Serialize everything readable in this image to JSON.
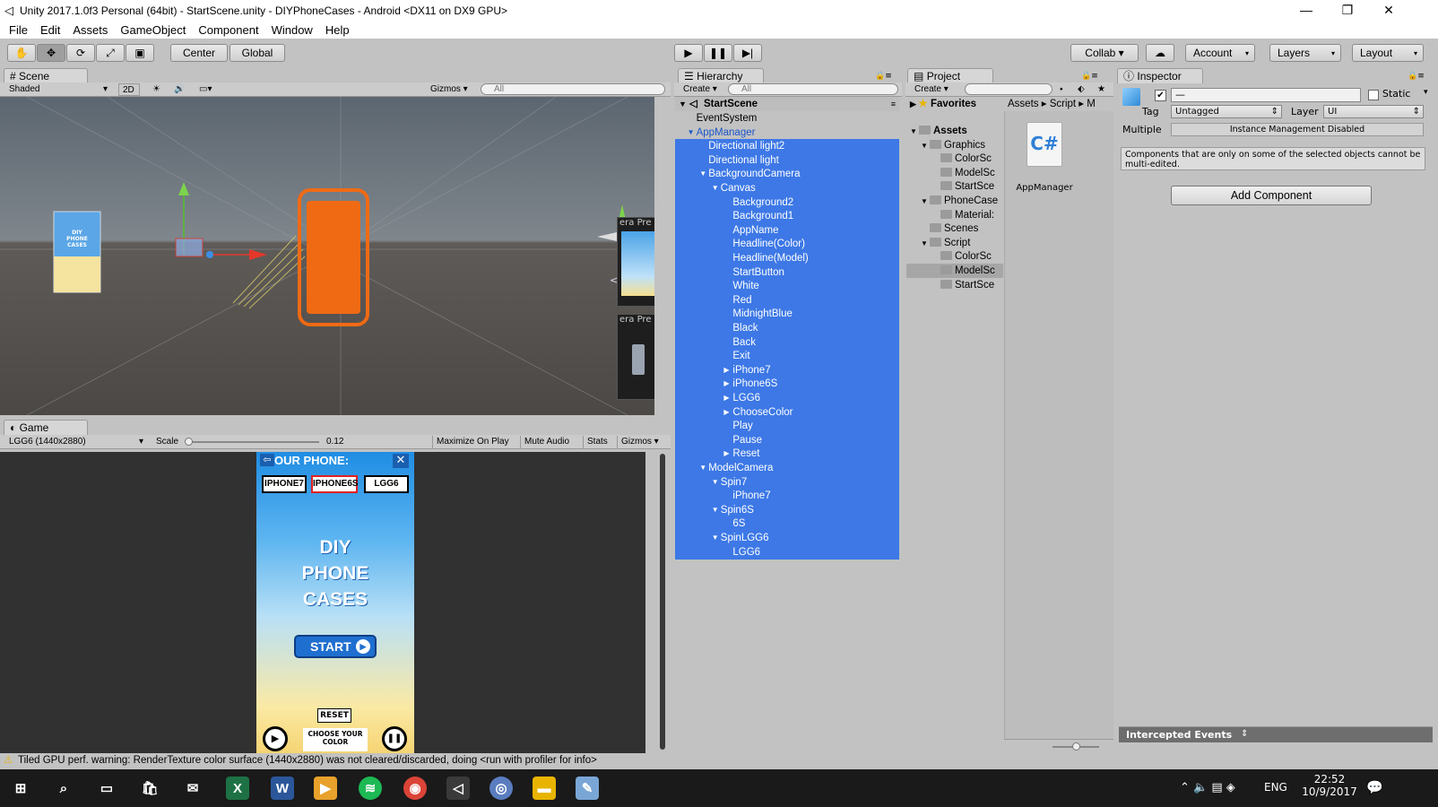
{
  "window": {
    "title": "Unity 2017.1.0f3 Personal (64bit) - StartScene.unity - DIYPhoneCases - Android <DX11 on DX9 GPU>",
    "minimize": "—",
    "maximize": "❐",
    "close": "✕"
  },
  "menu": [
    "File",
    "Edit",
    "Assets",
    "GameObject",
    "Component",
    "Window",
    "Help"
  ],
  "toolbar": {
    "pivot": "Center",
    "space": "Global",
    "collab": "Collab ▾",
    "account": "Account",
    "layers": "Layers",
    "layout": "Layout"
  },
  "scene_panel": {
    "tab": "Scene",
    "shading": "Shaded",
    "mode_2d": "2D",
    "gizmos": "Gizmos",
    "search_placeholder": "All",
    "persp_label": "< Back",
    "preview_label": "era Pre",
    "preview_label2": "era Pre"
  },
  "game_panel": {
    "tab": "Game",
    "resolution": "LGG6 (1440x2880)",
    "scale_label": "Scale",
    "scale_value": "0.12",
    "maximize": "Maximize On Play",
    "mute": "Mute Audio",
    "stats": "Stats",
    "gizmos": "Gizmos",
    "phone": {
      "header": "OUR PHONE:",
      "buttons": [
        "IPHONE7",
        "IPHONE6S",
        "LGG6"
      ],
      "title_lines": [
        "DIY",
        "PHONE",
        "CASES"
      ],
      "start": "START",
      "reset": "RESET",
      "choose": "CHOOSE YOUR COLOR"
    }
  },
  "hierarchy": {
    "tab": "Hierarchy",
    "create": "Create",
    "search_placeholder": "All",
    "scene": "StartScene",
    "items": [
      {
        "label": "EventSystem",
        "depth": 1,
        "arrow": "",
        "selected": false
      },
      {
        "label": "AppManager",
        "depth": 1,
        "arrow": "▼",
        "selected": false,
        "highlight": true
      },
      {
        "label": "Directional light2",
        "depth": 2,
        "arrow": "",
        "selected": true
      },
      {
        "label": "Directional light",
        "depth": 2,
        "arrow": "",
        "selected": true
      },
      {
        "label": "BackgroundCamera",
        "depth": 2,
        "arrow": "▼",
        "selected": true
      },
      {
        "label": "Canvas",
        "depth": 3,
        "arrow": "▼",
        "selected": true
      },
      {
        "label": "Background2",
        "depth": 4,
        "arrow": "",
        "selected": true
      },
      {
        "label": "Background1",
        "depth": 4,
        "arrow": "",
        "selected": true
      },
      {
        "label": "AppName",
        "depth": 4,
        "arrow": "",
        "selected": true
      },
      {
        "label": "Headline(Color)",
        "depth": 4,
        "arrow": "",
        "selected": true
      },
      {
        "label": "Headline(Model)",
        "depth": 4,
        "arrow": "",
        "selected": true
      },
      {
        "label": "StartButton",
        "depth": 4,
        "arrow": "",
        "selected": true
      },
      {
        "label": "White",
        "depth": 4,
        "arrow": "",
        "selected": true
      },
      {
        "label": "Red",
        "depth": 4,
        "arrow": "",
        "selected": true
      },
      {
        "label": "MidnightBlue",
        "depth": 4,
        "arrow": "",
        "selected": true
      },
      {
        "label": "Black",
        "depth": 4,
        "arrow": "",
        "selected": true
      },
      {
        "label": "Back",
        "depth": 4,
        "arrow": "",
        "selected": true
      },
      {
        "label": "Exit",
        "depth": 4,
        "arrow": "",
        "selected": true
      },
      {
        "label": "iPhone7",
        "depth": 4,
        "arrow": "▶",
        "selected": true
      },
      {
        "label": "iPhone6S",
        "depth": 4,
        "arrow": "▶",
        "selected": true
      },
      {
        "label": "LGG6",
        "depth": 4,
        "arrow": "▶",
        "selected": true
      },
      {
        "label": "ChooseColor",
        "depth": 4,
        "arrow": "▶",
        "selected": true
      },
      {
        "label": "Play",
        "depth": 4,
        "arrow": "",
        "selected": true
      },
      {
        "label": "Pause",
        "depth": 4,
        "arrow": "",
        "selected": true
      },
      {
        "label": "Reset",
        "depth": 4,
        "arrow": "▶",
        "selected": true
      },
      {
        "label": "ModelCamera",
        "depth": 2,
        "arrow": "▼",
        "selected": true
      },
      {
        "label": "Spin7",
        "depth": 3,
        "arrow": "▼",
        "selected": true
      },
      {
        "label": "iPhone7",
        "depth": 4,
        "arrow": "",
        "selected": true
      },
      {
        "label": "Spin6S",
        "depth": 3,
        "arrow": "▼",
        "selected": true
      },
      {
        "label": "6S",
        "depth": 4,
        "arrow": "",
        "selected": true
      },
      {
        "label": "SpinLGG6",
        "depth": 3,
        "arrow": "▼",
        "selected": true
      },
      {
        "label": "LGG6",
        "depth": 4,
        "arrow": "",
        "selected": true
      }
    ]
  },
  "project": {
    "tab": "Project",
    "create": "Create",
    "breadcrumb": [
      "Assets",
      "Script",
      "M"
    ],
    "favorites": "Favorites",
    "tree": [
      {
        "label": "Assets",
        "depth": 0,
        "arrow": "▼",
        "bold": true
      },
      {
        "label": "Graphics",
        "depth": 1,
        "arrow": "▼"
      },
      {
        "label": "ColorSc",
        "depth": 2,
        "arrow": ""
      },
      {
        "label": "ModelSc",
        "depth": 2,
        "arrow": ""
      },
      {
        "label": "StartSce",
        "depth": 2,
        "arrow": ""
      },
      {
        "label": "PhoneCase",
        "depth": 1,
        "arrow": "▼"
      },
      {
        "label": "Material:",
        "depth": 2,
        "arrow": ""
      },
      {
        "label": "Scenes",
        "depth": 1,
        "arrow": ""
      },
      {
        "label": "Script",
        "depth": 1,
        "arrow": "▼"
      },
      {
        "label": "ColorSc",
        "depth": 2,
        "arrow": ""
      },
      {
        "label": "ModelSc",
        "depth": 2,
        "arrow": "",
        "selected": true
      },
      {
        "label": "StartSce",
        "depth": 2,
        "arrow": ""
      }
    ],
    "asset": {
      "label": "AppManager",
      "icon": "C#"
    }
  },
  "inspector": {
    "tab": "Inspector",
    "name_value": "—",
    "static": "Static",
    "tag_label": "Tag",
    "tag_value": "Untagged",
    "layer_label": "Layer",
    "layer_value": "UI",
    "multiple_label": "Multiple",
    "multiple_value": "Instance Management Disabled",
    "notice": "Components that are only on some of the selected objects cannot be multi-edited.",
    "add_component": "Add Component",
    "intercepted": "Intercepted Events"
  },
  "status": {
    "message": "Tiled GPU perf. warning: RenderTexture color surface  (1440x2880) was not cleared/discarded, doing <run with profiler for info>"
  },
  "taskbar": {
    "lang": "ENG",
    "time": "22:52",
    "date": "10/9/2017"
  },
  "colors": {
    "selection": "#3d78e6",
    "orange_case": "#f06a14",
    "panel": "#c2c2c2"
  }
}
